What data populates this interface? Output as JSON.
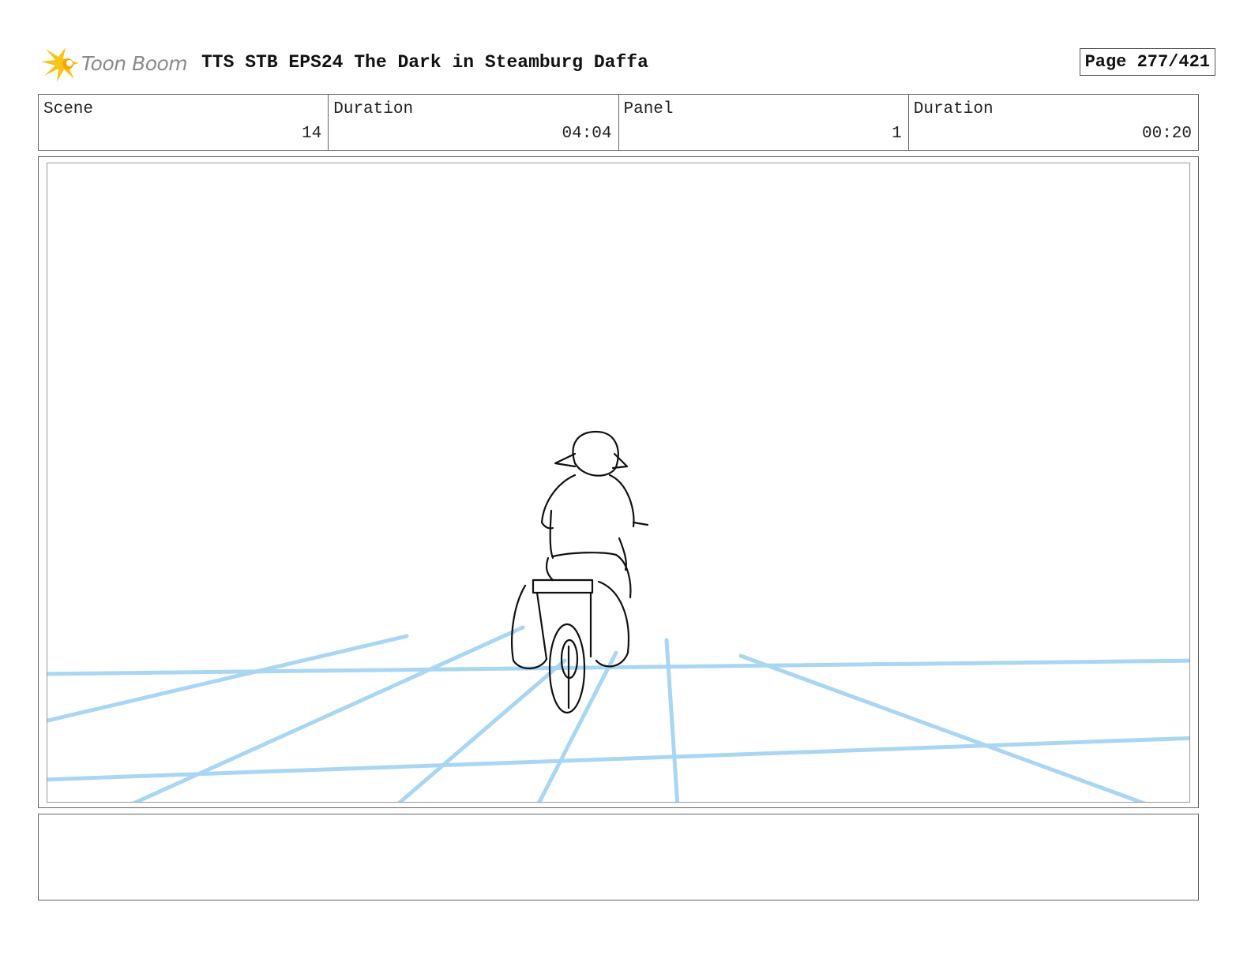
{
  "header": {
    "logo_text": "Toon Boom",
    "title": "TTS STB EPS24 The Dark in Steamburg Daffa",
    "page": "Page 277/421"
  },
  "info": {
    "scene_label": "Scene",
    "scene_value": "14",
    "scene_duration_label": "Duration",
    "scene_duration_value": "04:04",
    "panel_label": "Panel",
    "panel_value": "1",
    "panel_duration_label": "Duration",
    "panel_duration_value": "00:20"
  },
  "colors": {
    "logo_star": "#f5c518",
    "guide_lines": "#a9d6f2",
    "sketch_ink": "#111111"
  },
  "panel": {
    "image": "rough-sketch-child-on-bicycle-riding-away"
  },
  "notes": {
    "text": ""
  }
}
